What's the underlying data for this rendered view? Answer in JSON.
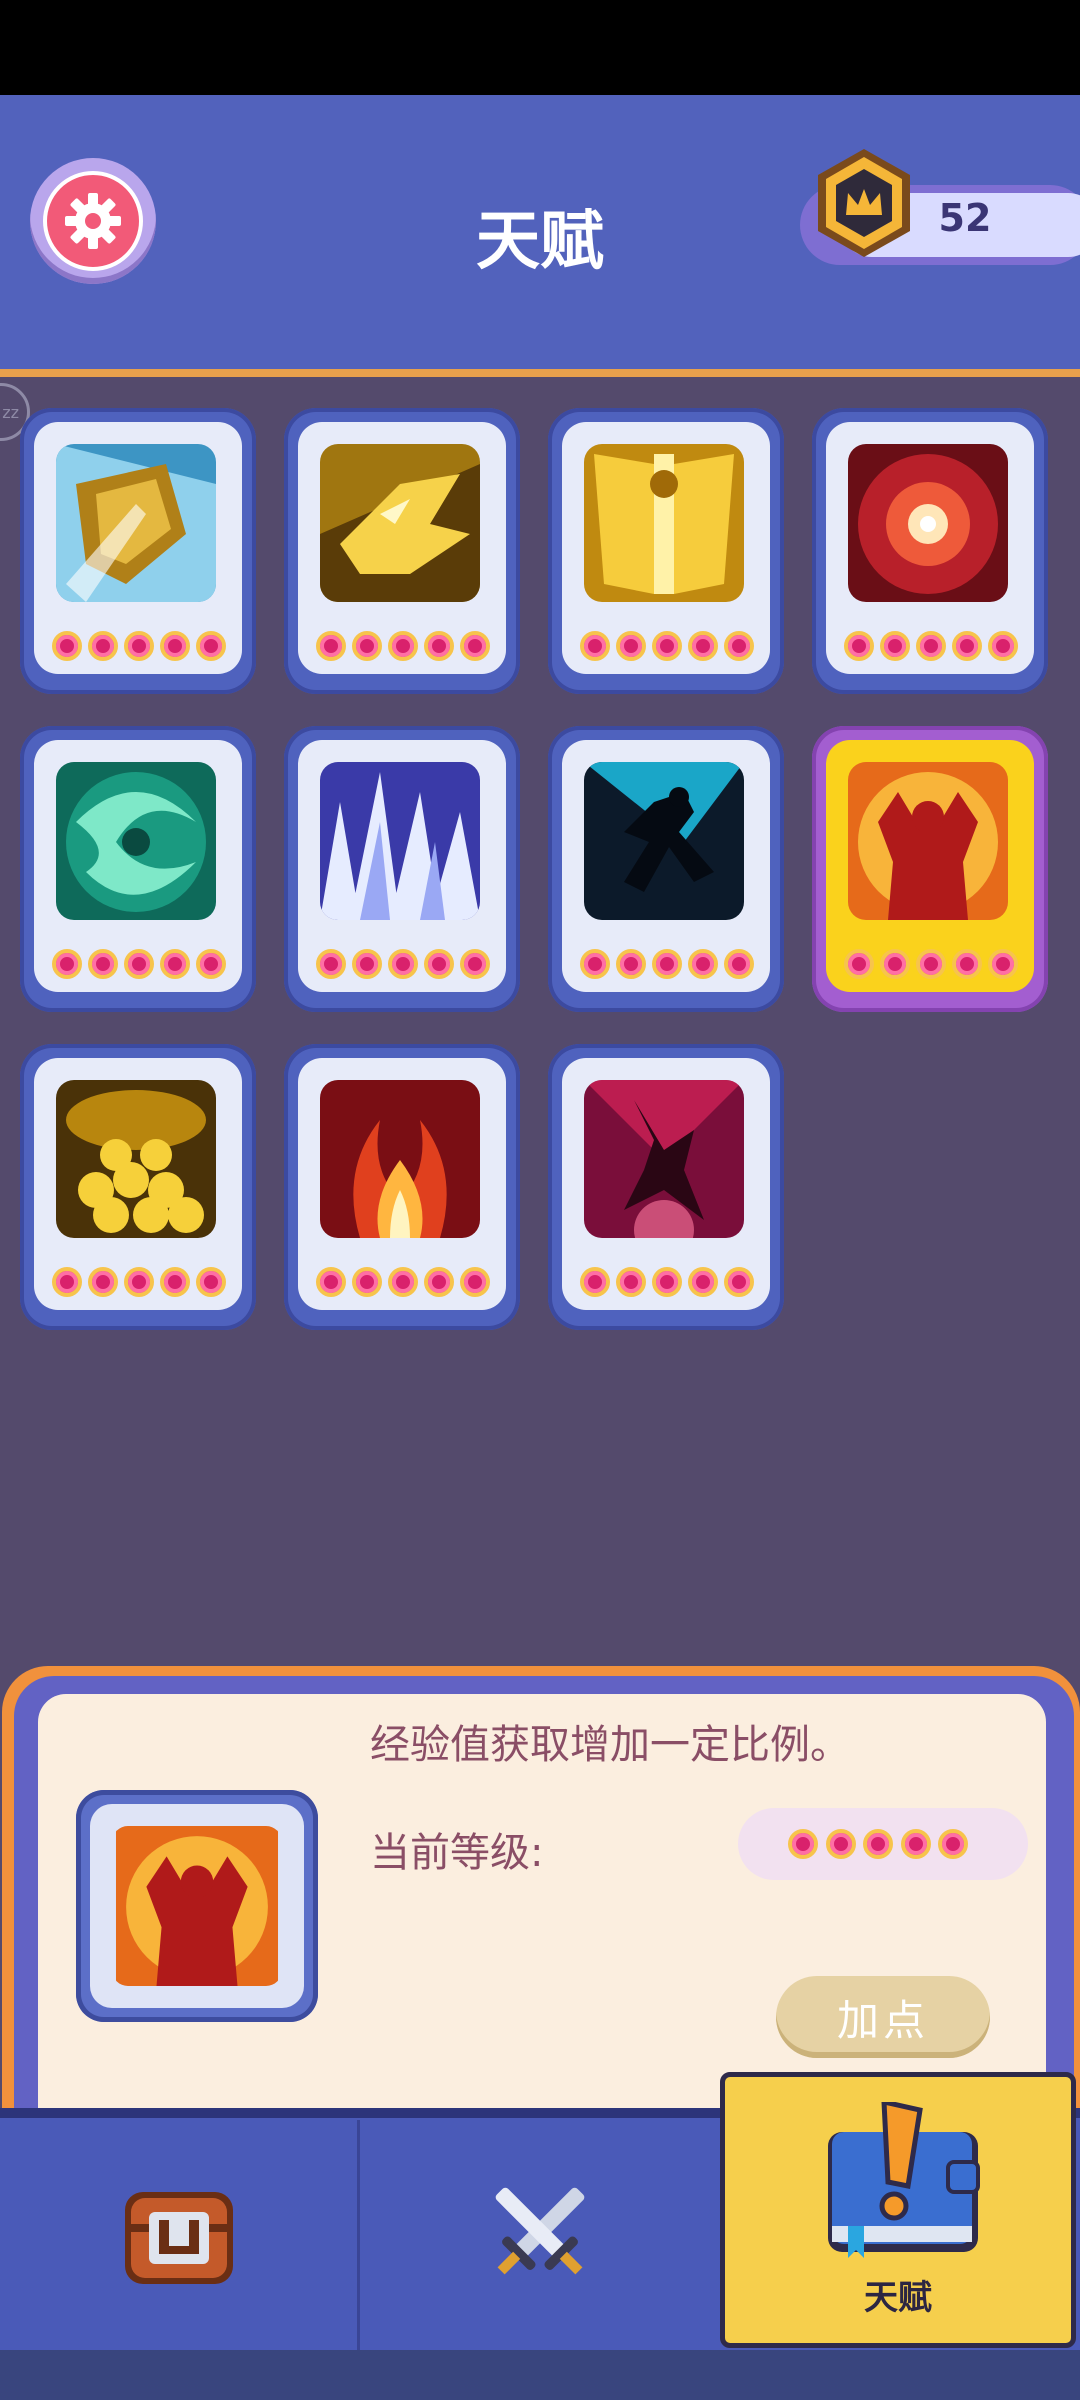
{
  "header": {
    "title": "天赋",
    "currency_value": "52"
  },
  "talents": [
    {
      "name": "fist",
      "selected": false
    },
    {
      "name": "golden-dragon",
      "selected": false
    },
    {
      "name": "golden-armor",
      "selected": false
    },
    {
      "name": "red-burst",
      "selected": false
    },
    {
      "name": "green-whirlwind",
      "selected": false
    },
    {
      "name": "ice-spikes",
      "selected": false
    },
    {
      "name": "shadow-runner",
      "selected": false
    },
    {
      "name": "flame-giant",
      "selected": true
    },
    {
      "name": "gold-coins",
      "selected": false
    },
    {
      "name": "fire-pillar",
      "selected": false
    },
    {
      "name": "crimson-demon",
      "selected": false
    }
  ],
  "detail": {
    "description": "经验值获取增加一定比例。",
    "level_label": "当前等级:",
    "add_button": "加点"
  },
  "nav": {
    "talent_label": "天赋"
  },
  "colors": {
    "header_bg": "#5262bc",
    "page_bg": "#544a6c",
    "accent_orange": "#e8a04c",
    "selected_card": "#fad21c",
    "gem": "#d9216c"
  }
}
